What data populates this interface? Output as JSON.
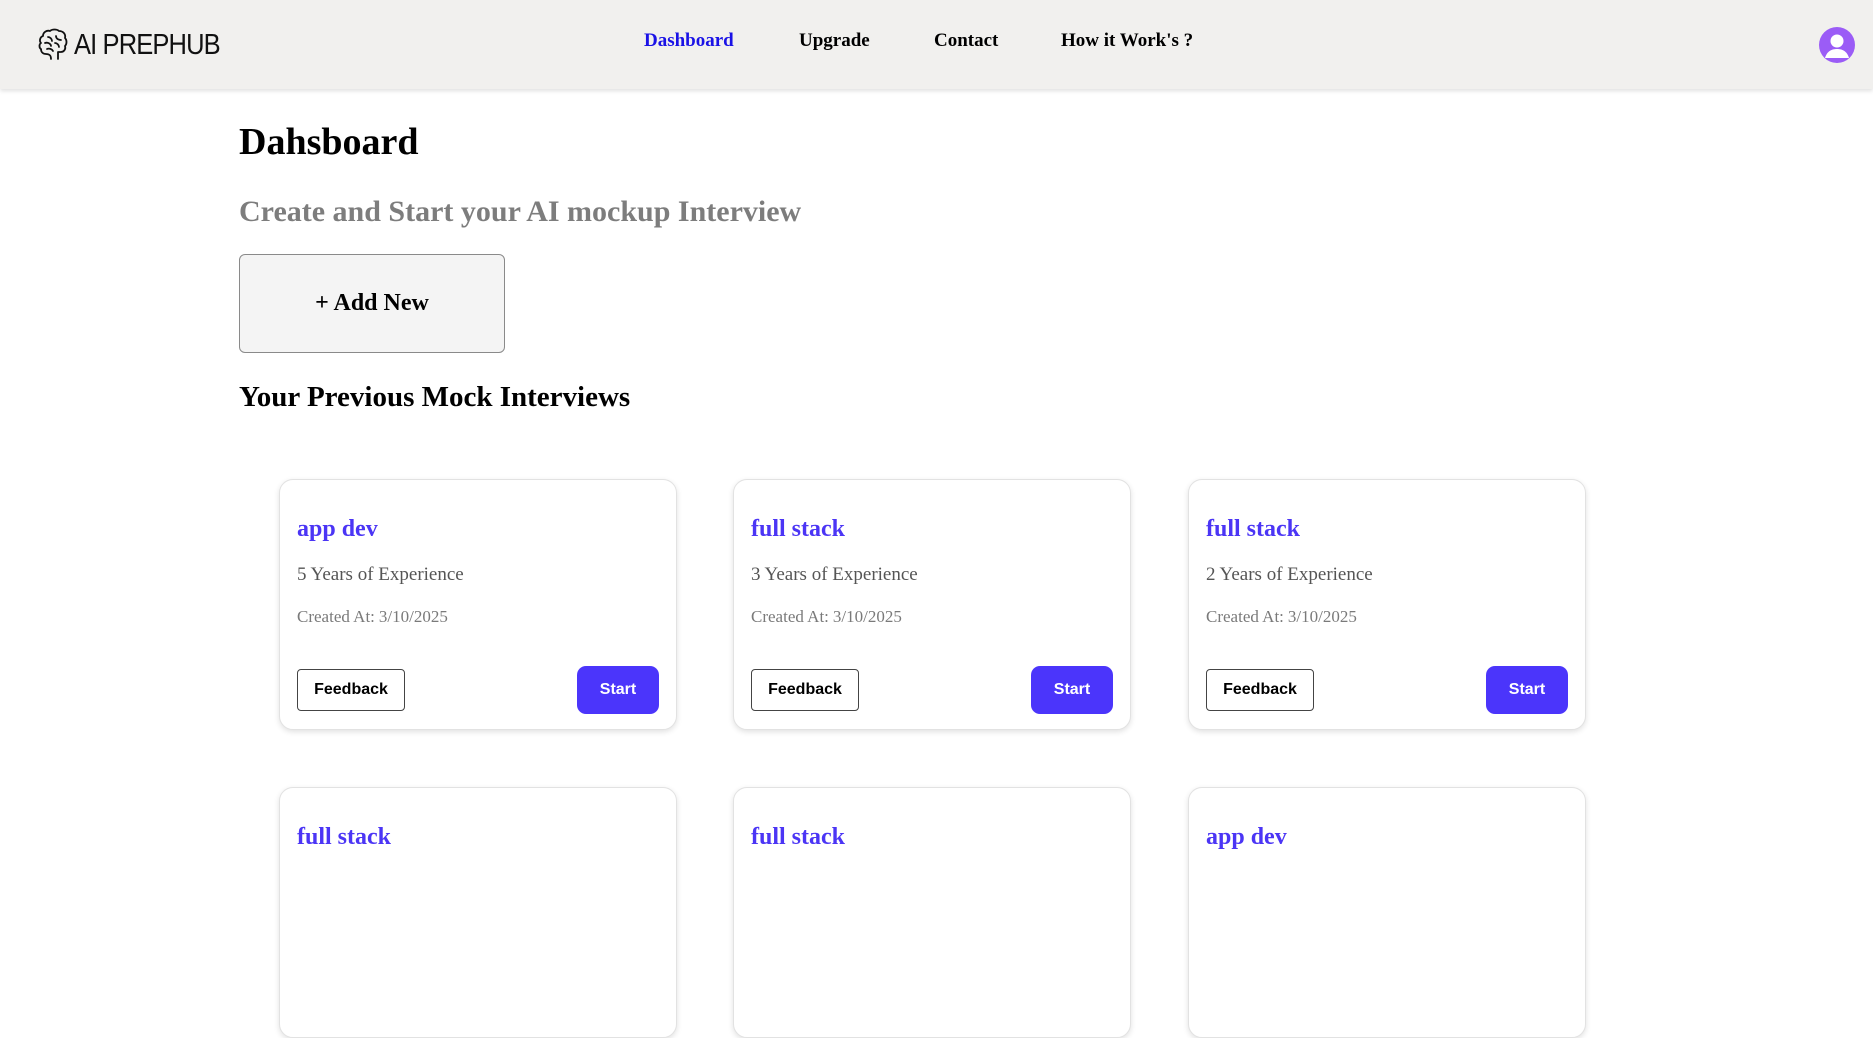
{
  "header": {
    "logo_text": "AI PREPHUB",
    "logo_icon": "brain-icon",
    "nav": [
      {
        "label": "Dashboard",
        "active": true
      },
      {
        "label": "Upgrade",
        "active": false
      },
      {
        "label": "Contact",
        "active": false
      },
      {
        "label": "How it Work's ?",
        "active": false
      }
    ],
    "avatar_icon": "user-avatar-icon"
  },
  "main": {
    "title": "Dahsboard",
    "subtitle": "Create and Start your AI mockup Interview",
    "add_new_label": "+ Add New",
    "section_title": "Your Previous Mock Interviews",
    "interviews": [
      {
        "role": "app dev",
        "experience": "5 Years of Experience",
        "created_label": "Created At:",
        "created_at": "3/10/2025",
        "feedback_label": "Feedback",
        "start_label": "Start"
      },
      {
        "role": "full stack",
        "experience": "3 Years of Experience",
        "created_label": "Created At:",
        "created_at": "3/10/2025",
        "feedback_label": "Feedback",
        "start_label": "Start"
      },
      {
        "role": "full stack",
        "experience": "2 Years of Experience",
        "created_label": "Created At:",
        "created_at": "3/10/2025",
        "feedback_label": "Feedback",
        "start_label": "Start"
      },
      {
        "role": "full stack"
      },
      {
        "role": "full stack"
      },
      {
        "role": "app dev"
      }
    ]
  },
  "colors": {
    "header_bg": "#f1f0ee",
    "nav_active": "#1a12e6",
    "accent": "#4b35fb",
    "avatar": "#9b5cf6",
    "subtitle": "#7d7d7d"
  }
}
